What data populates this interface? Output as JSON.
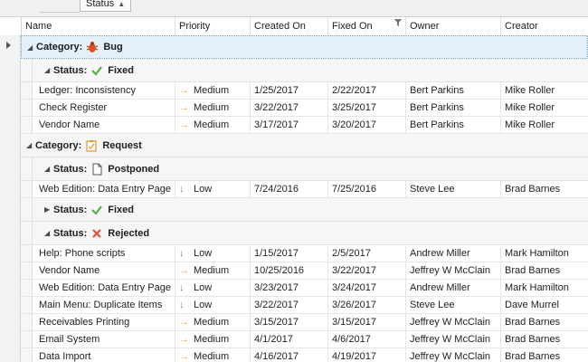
{
  "group_panel": {
    "chip_label": "Status",
    "sort_glyph": "▲"
  },
  "columns": [
    {
      "key": "name",
      "label": "Name",
      "filter": false
    },
    {
      "key": "priority",
      "label": "Priority",
      "filter": false
    },
    {
      "key": "created",
      "label": "Created On",
      "filter": false
    },
    {
      "key": "fixed",
      "label": "Fixed On",
      "filter": true
    },
    {
      "key": "owner",
      "label": "Owner",
      "filter": false
    },
    {
      "key": "creator",
      "label": "Creator",
      "filter": false
    }
  ],
  "group_labels": {
    "category": "Category:",
    "status": "Status:"
  },
  "colors": {
    "medium_arrow": "#e8b316",
    "low_arrow": "#4caf3e",
    "bug": "#d9541f",
    "fixed": "#4caf3e",
    "rejected": "#e2482c"
  },
  "rows": [
    {
      "kind": "group",
      "level": 0,
      "expanded": true,
      "selected": true,
      "label": "Category:",
      "value": "Bug",
      "icon": "bug-icon"
    },
    {
      "kind": "group",
      "level": 1,
      "expanded": true,
      "label": "Status:",
      "value": "Fixed",
      "icon": "check-icon"
    },
    {
      "kind": "data",
      "name": "Ledger: Inconsistency",
      "priority": "Medium",
      "created": "1/25/2017",
      "fixed": "2/22/2017",
      "owner": "Bert Parkins",
      "creator": "Mike Roller"
    },
    {
      "kind": "data",
      "name": "Check Register",
      "priority": "Medium",
      "created": "3/22/2017",
      "fixed": "3/25/2017",
      "owner": "Bert Parkins",
      "creator": "Mike Roller"
    },
    {
      "kind": "data",
      "name": "Vendor Name",
      "priority": "Medium",
      "created": "3/17/2017",
      "fixed": "3/20/2017",
      "owner": "Bert Parkins",
      "creator": "Mike Roller"
    },
    {
      "kind": "group",
      "level": 0,
      "expanded": true,
      "label": "Category:",
      "value": "Request",
      "icon": "clipboard-icon"
    },
    {
      "kind": "group",
      "level": 1,
      "expanded": true,
      "label": "Status:",
      "value": "Postponed",
      "icon": "document-icon"
    },
    {
      "kind": "data",
      "name": "Web Edition: Data Entry Page",
      "priority": "Low",
      "created": "7/24/2016",
      "fixed": "7/25/2016",
      "owner": "Steve Lee",
      "creator": "Brad Barnes"
    },
    {
      "kind": "group",
      "level": 1,
      "expanded": false,
      "label": "Status:",
      "value": "Fixed",
      "icon": "check-icon"
    },
    {
      "kind": "group",
      "level": 1,
      "expanded": true,
      "label": "Status:",
      "value": "Rejected",
      "icon": "cross-icon"
    },
    {
      "kind": "data",
      "name": "Help: Phone scripts",
      "priority": "Low",
      "created": "1/15/2017",
      "fixed": "2/5/2017",
      "owner": "Andrew Miller",
      "creator": "Mark Hamilton"
    },
    {
      "kind": "data",
      "name": "Vendor Name",
      "priority": "Medium",
      "created": "10/25/2016",
      "fixed": "3/22/2017",
      "owner": "Jeffrey W McClain",
      "creator": "Brad Barnes"
    },
    {
      "kind": "data",
      "name": "Web Edition: Data Entry Page",
      "priority": "Low",
      "created": "3/23/2017",
      "fixed": "3/24/2017",
      "owner": "Andrew Miller",
      "creator": "Mark Hamilton"
    },
    {
      "kind": "data",
      "name": "Main Menu: Duplicate Items",
      "priority": "Low",
      "created": "3/22/2017",
      "fixed": "3/26/2017",
      "owner": "Steve Lee",
      "creator": "Dave Murrel"
    },
    {
      "kind": "data",
      "name": "Receivables Printing",
      "priority": "Medium",
      "created": "3/15/2017",
      "fixed": "3/15/2017",
      "owner": "Jeffrey W McClain",
      "creator": "Brad Barnes"
    },
    {
      "kind": "data",
      "name": "Email System",
      "priority": "Medium",
      "created": "4/1/2017",
      "fixed": "4/6/2017",
      "owner": "Jeffrey W McClain",
      "creator": "Brad Barnes"
    },
    {
      "kind": "data",
      "name": "Data Import",
      "priority": "Medium",
      "created": "4/16/2017",
      "fixed": "4/19/2017",
      "owner": "Jeffrey W McClain",
      "creator": "Brad Barnes"
    }
  ]
}
